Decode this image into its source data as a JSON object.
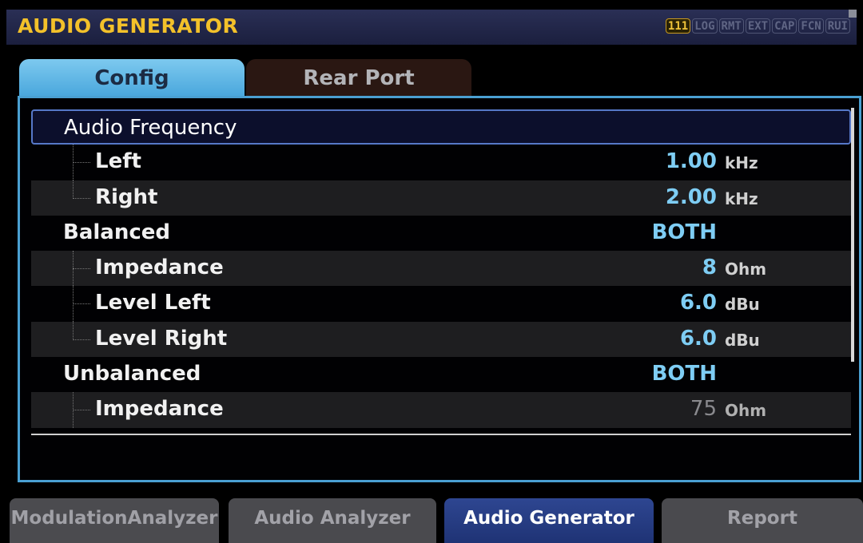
{
  "header": {
    "title": "AUDIO GENERATOR",
    "indicators": [
      "111",
      "LOG",
      "RMT",
      "EXT",
      "CAP",
      "FCN",
      "RUI"
    ]
  },
  "tabs": [
    {
      "label": "Config",
      "active": true
    },
    {
      "label": "Rear Port",
      "active": false
    }
  ],
  "rows": [
    {
      "label": "Audio Frequency",
      "value": "",
      "unit": ""
    },
    {
      "label": "Left",
      "value": "1.00",
      "unit": "kHz"
    },
    {
      "label": "Right",
      "value": "2.00",
      "unit": "kHz"
    },
    {
      "label": "Balanced",
      "value": "BOTH",
      "unit": ""
    },
    {
      "label": "Impedance",
      "value": "8",
      "unit": "Ohm"
    },
    {
      "label": "Level Left",
      "value": "6.0",
      "unit": "dBu"
    },
    {
      "label": "Level Right",
      "value": "6.0",
      "unit": "dBu"
    },
    {
      "label": "Unbalanced",
      "value": "BOTH",
      "unit": ""
    },
    {
      "label": "Impedance",
      "value": "75",
      "unit": "Ohm"
    }
  ],
  "bottom_buttons": [
    {
      "label": "ModulationAnalyzer",
      "active": false
    },
    {
      "label": "Audio Analyzer",
      "active": false
    },
    {
      "label": "Audio Generator",
      "active": true
    },
    {
      "label": "Report",
      "active": false
    }
  ],
  "colors": {
    "title": "#f3c12a",
    "value": "#7ecdf4",
    "tab_active": "#48a6dc",
    "panel_border": "#4aa0d2",
    "button_active": "#2e4691"
  }
}
